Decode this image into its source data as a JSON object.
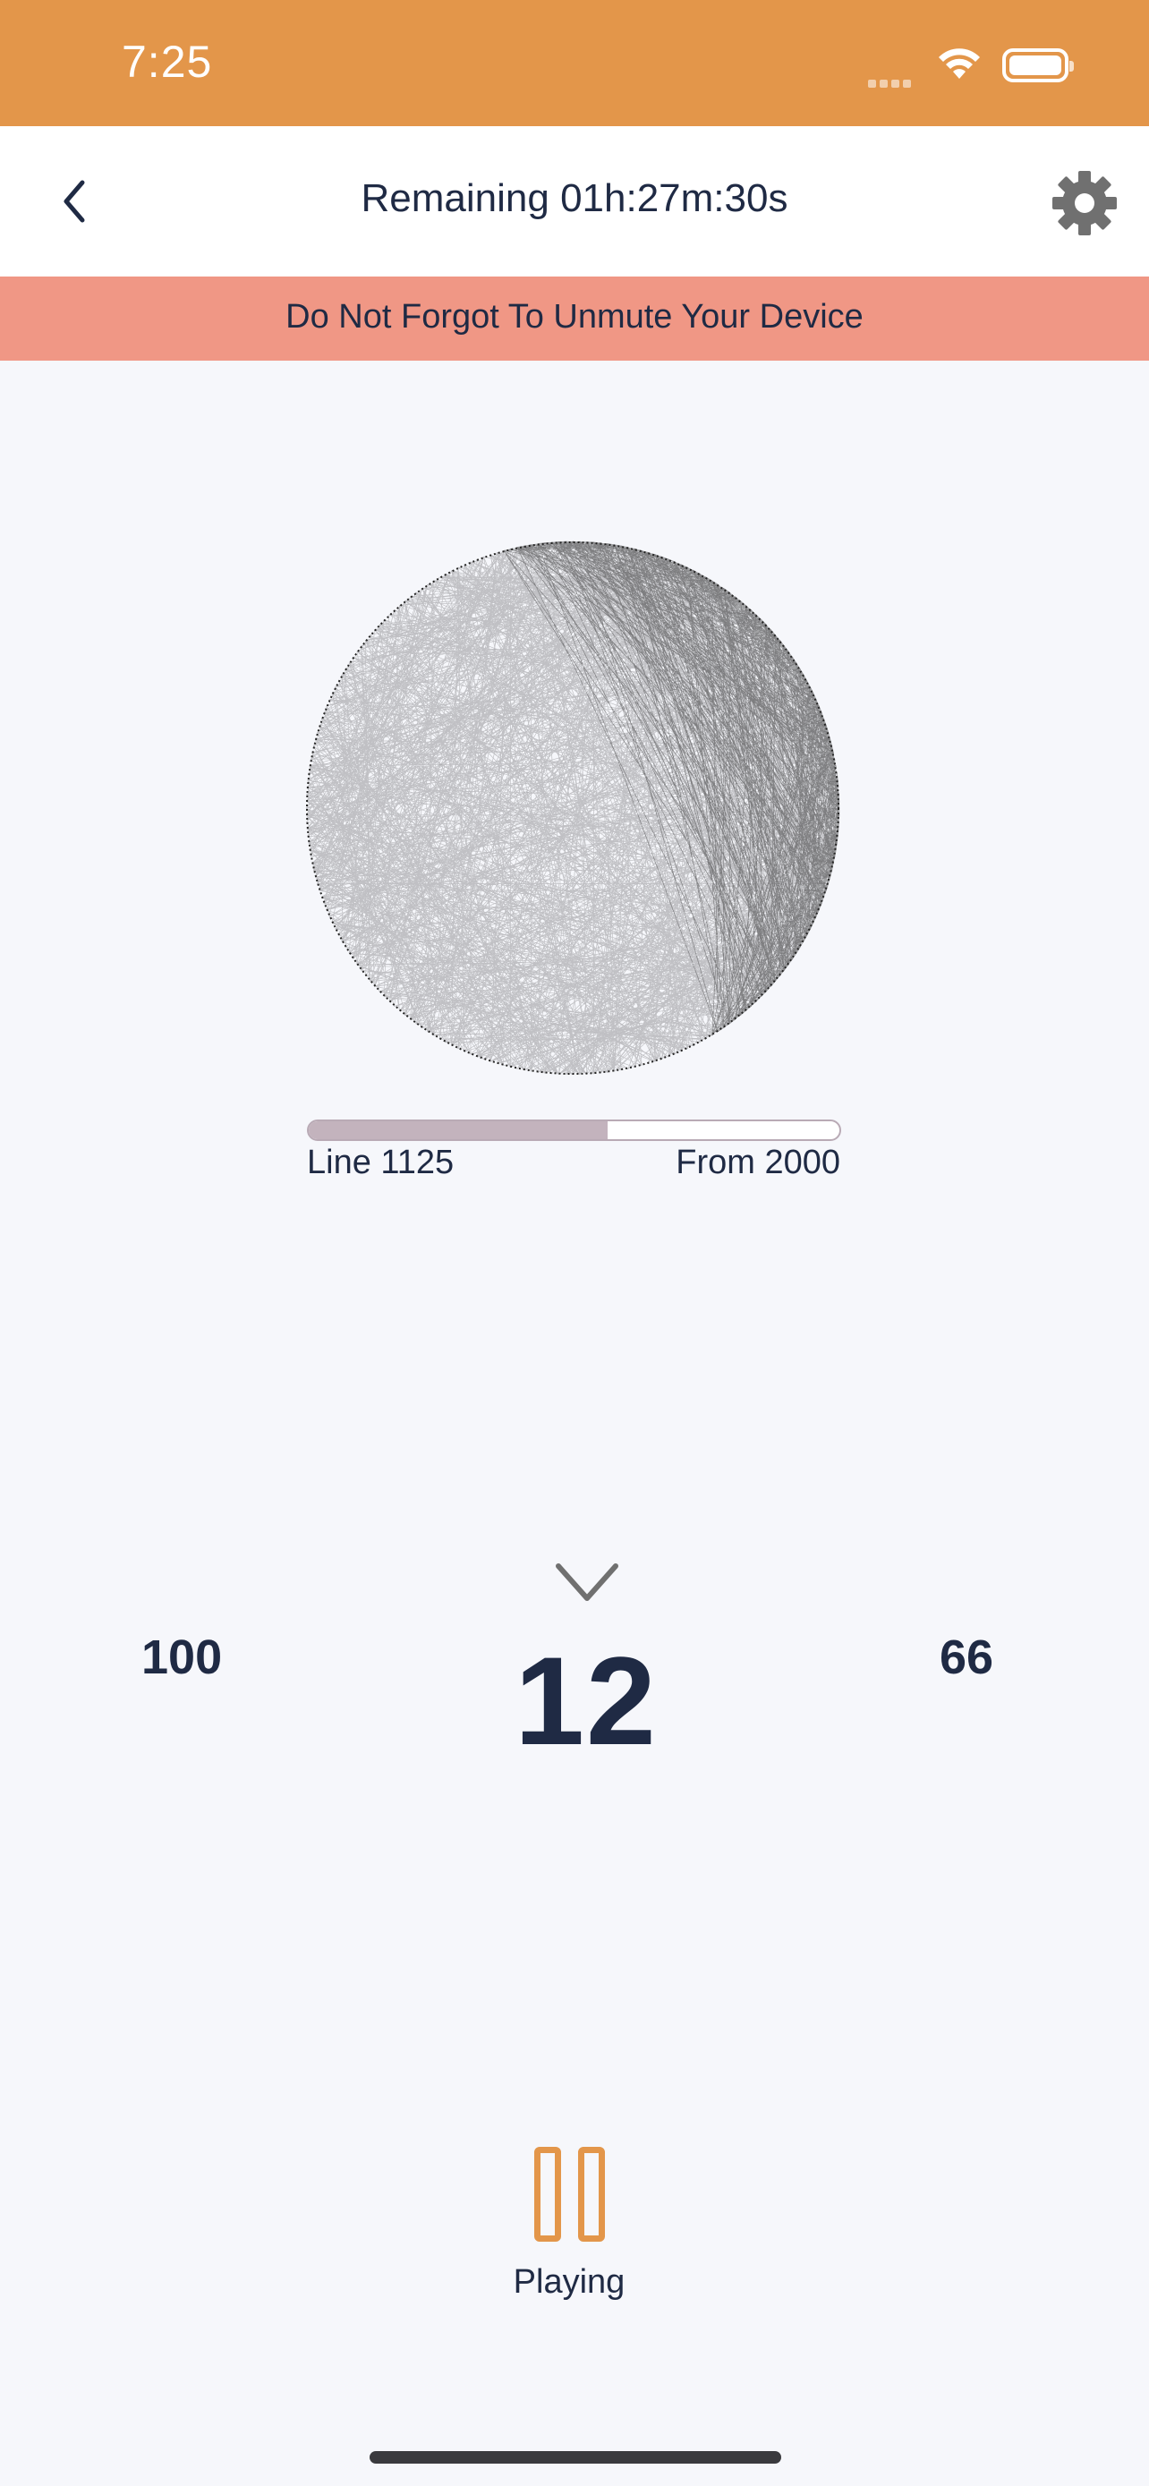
{
  "status_bar": {
    "time": "7:25",
    "icons": [
      "cellular-signal-icon",
      "wifi-icon",
      "battery-icon"
    ]
  },
  "header": {
    "back_icon": "chevron-left-icon",
    "title": "Remaining 01h:27m:30s",
    "settings_icon": "gear-icon"
  },
  "banner": {
    "text": "Do Not Forgot To Unmute Your Device"
  },
  "progress": {
    "fraction": 0.5625,
    "line_label": "Line 1125",
    "from_label": "From 2000"
  },
  "pins": {
    "indicator_icon": "chevron-down-icon",
    "previous": "100",
    "current": "12",
    "next": "66"
  },
  "playback": {
    "icon": "pause-icon",
    "status": "Playing"
  },
  "colors": {
    "accent": "#e3964a",
    "banner": "#f09785",
    "text": "#1f2a44",
    "background": "#f6f7fb",
    "progress_fill": "#c3b3bd"
  }
}
